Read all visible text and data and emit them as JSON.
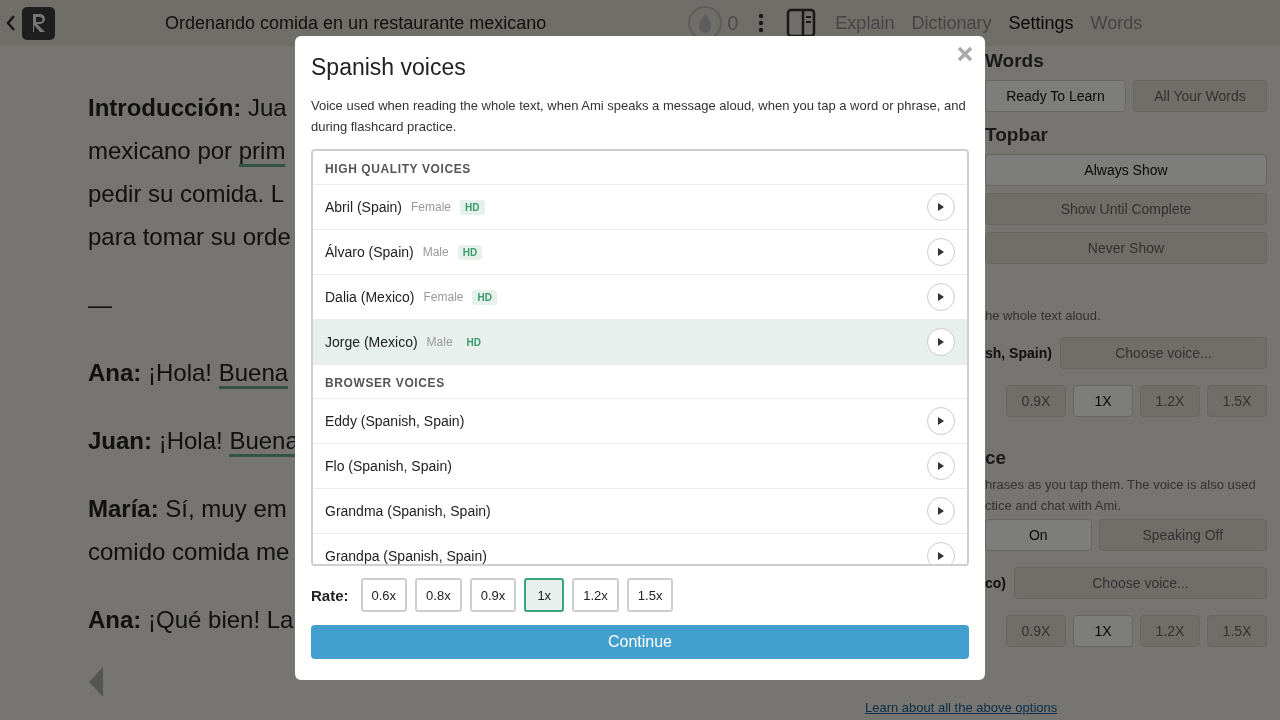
{
  "topbar": {
    "title": "Ordenando comida en un restaurante mexicano",
    "streak": "0",
    "tabs": [
      {
        "label": "Explain",
        "selected": false
      },
      {
        "label": "Dictionary",
        "selected": false
      },
      {
        "label": "Settings",
        "selected": true
      },
      {
        "label": "Words",
        "selected": false
      }
    ]
  },
  "reader": {
    "blocks": [
      {
        "lines": [
          [
            {
              "text": "**Introducción:** Jua"
            }
          ],
          [
            {
              "text": "mexicano por "
            },
            {
              "text": "prim",
              "underlined": true
            }
          ],
          [
            {
              "text": "pedir su comida. L"
            }
          ],
          [
            {
              "text": "para tomar su orde"
            }
          ]
        ]
      },
      {
        "lines": [
          [
            {
              "text": "—"
            }
          ]
        ]
      },
      {
        "lines": [
          [
            {
              "text": "**Ana:** ¡Hola! "
            },
            {
              "text": "Buena",
              "underlined": true
            }
          ]
        ]
      },
      {
        "lines": [
          [
            {
              "text": "**Juan:** ¡Hola! "
            },
            {
              "text": "Buena",
              "underlined": true
            }
          ]
        ]
      },
      {
        "lines": [
          [
            {
              "text": "**María:** Sí, muy em"
            }
          ],
          [
            {
              "text": "comido comida me"
            }
          ]
        ]
      },
      {
        "lines": [
          [
            {
              "text": "**Ana:** ¡Qué bien! La"
            }
          ]
        ]
      }
    ]
  },
  "settings": {
    "items": [
      {
        "kind": "heading",
        "text": "Words"
      },
      {
        "kind": "buttons",
        "buttons": [
          {
            "label": "Ready To Learn",
            "selected": true
          },
          {
            "label": "All Your Words",
            "selected": false
          }
        ]
      },
      {
        "kind": "heading",
        "text": "Topbar"
      },
      {
        "kind": "stack",
        "buttons": [
          {
            "label": "Always Show",
            "selected": true
          },
          {
            "label": "Show Until Complete",
            "selected": false
          },
          {
            "label": "Never Show",
            "selected": false
          }
        ]
      },
      {
        "kind": "text",
        "text": "he whole text aloud."
      },
      {
        "kind": "voice",
        "label": "sh, Spain)",
        "button": "Choose voice..."
      },
      {
        "kind": "rates",
        "buttons": [
          {
            "label": "0.9X",
            "selected": false
          },
          {
            "label": "1X",
            "selected": true
          },
          {
            "label": "1.2X",
            "selected": false
          },
          {
            "label": "1.5X",
            "selected": false
          }
        ]
      },
      {
        "kind": "heading",
        "text": "ce"
      },
      {
        "kind": "text",
        "text": "hrases as you tap them. The voice is also used"
      },
      {
        "kind": "text",
        "text": "ctice and chat with Ami."
      },
      {
        "kind": "buttons",
        "buttons": [
          {
            "label": "On",
            "selected": true
          },
          {
            "label": "Speaking Off",
            "selected": false
          }
        ]
      },
      {
        "kind": "voice",
        "label": "co)",
        "button": "Choose voice..."
      },
      {
        "kind": "rates",
        "buttons": [
          {
            "label": "0.9X",
            "selected": false
          },
          {
            "label": "1X",
            "selected": true
          },
          {
            "label": "1.2X",
            "selected": false
          },
          {
            "label": "1.5X",
            "selected": false
          }
        ]
      }
    ],
    "link": "Learn about all the above options"
  },
  "modal": {
    "title": "Spanish voices",
    "description": "Voice used when reading the whole text, when Ami speaks a message aloud, when you tap a word or phrase, and during flashcard practice.",
    "sections": [
      {
        "heading": "HIGH QUALITY VOICES",
        "voices": [
          {
            "name": "Abril (Spain)",
            "gender": "Female",
            "badge": "HD",
            "selected": false
          },
          {
            "name": "Álvaro (Spain)",
            "gender": "Male",
            "badge": "HD",
            "selected": false
          },
          {
            "name": "Dalia (Mexico)",
            "gender": "Female",
            "badge": "HD",
            "selected": false
          },
          {
            "name": "Jorge (Mexico)",
            "gender": "Male",
            "badge": "HD",
            "selected": true
          }
        ]
      },
      {
        "heading": "BROWSER VOICES",
        "voices": [
          {
            "name": "Eddy (Spanish, Spain)",
            "selected": false
          },
          {
            "name": "Flo (Spanish, Spain)",
            "selected": false
          },
          {
            "name": "Grandma (Spanish, Spain)",
            "selected": false
          },
          {
            "name": "Grandpa (Spanish, Spain)",
            "selected": false
          }
        ]
      }
    ],
    "rate_label": "Rate:",
    "rates": [
      {
        "label": "0.6x",
        "selected": false
      },
      {
        "label": "0.8x",
        "selected": false
      },
      {
        "label": "0.9x",
        "selected": false
      },
      {
        "label": "1x",
        "selected": true
      },
      {
        "label": "1.2x",
        "selected": false
      },
      {
        "label": "1.5x",
        "selected": false
      }
    ],
    "continue": "Continue"
  }
}
